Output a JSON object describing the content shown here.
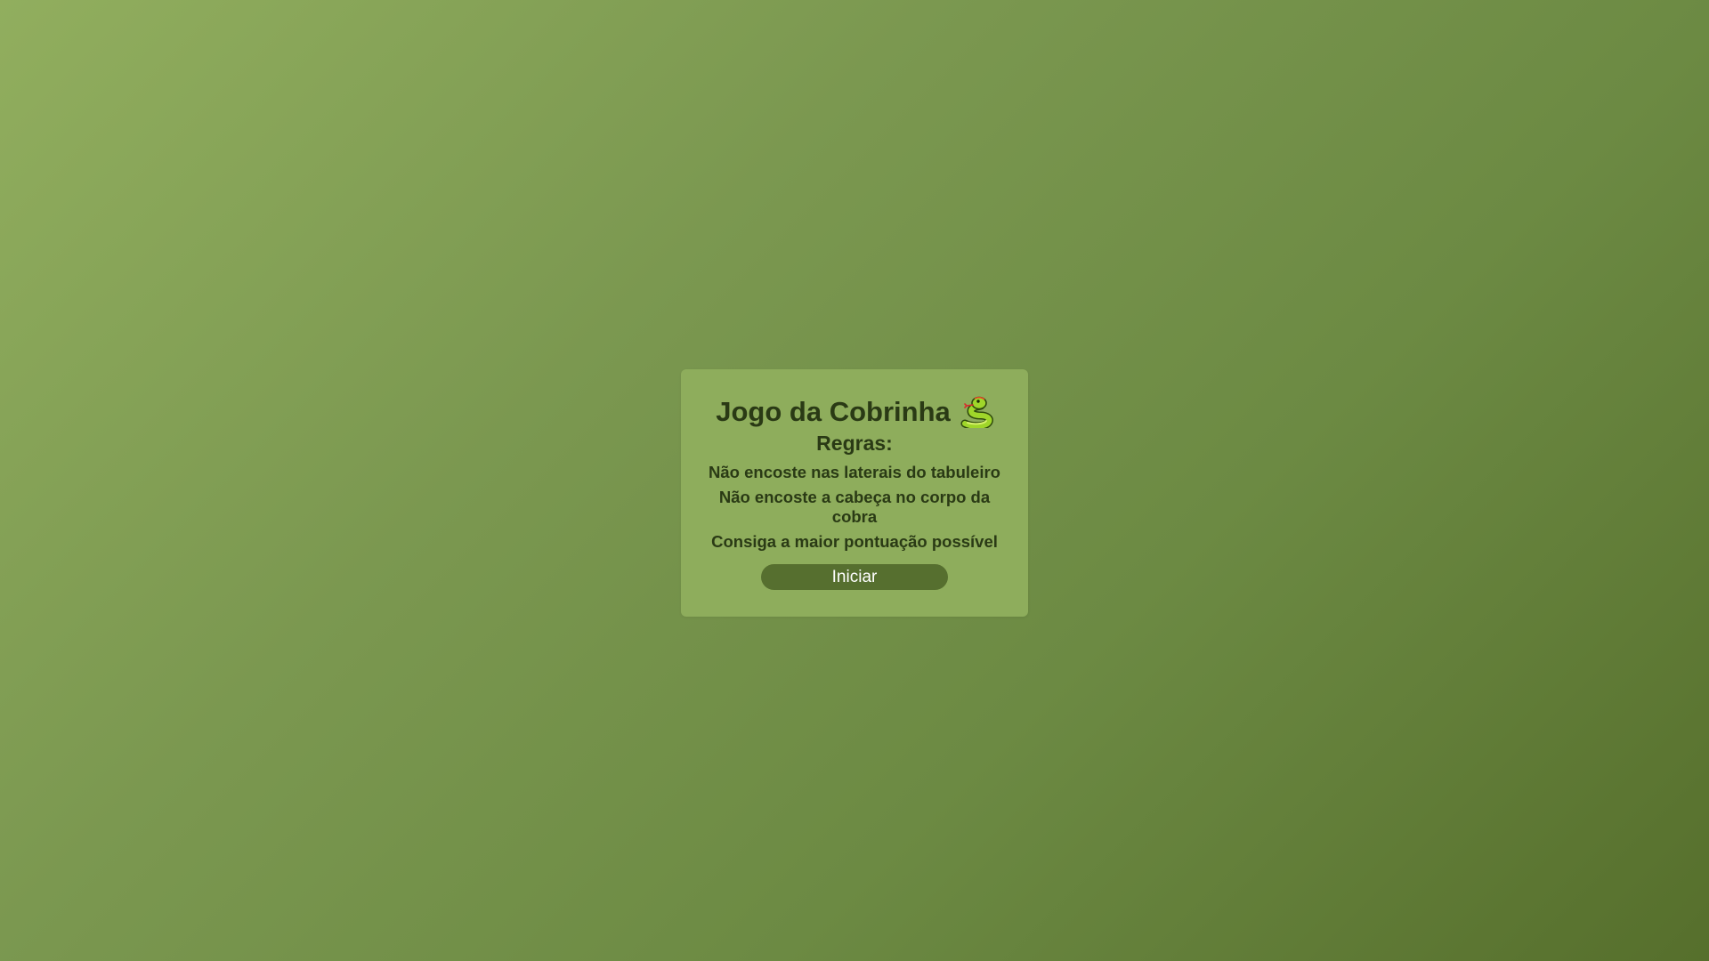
{
  "start_screen": {
    "title": "Jogo da Cobrinha",
    "title_icon": "snake-icon",
    "rules_heading": "Regras:",
    "rules": [
      "Não encoste nas laterais do tabuleiro",
      "Não encoste a cabeça no corpo da cobra",
      "Consiga a maior pontuação possível"
    ],
    "start_button_label": "Iniciar"
  },
  "colors": {
    "background_light": "#91ae5e",
    "background_dark": "#566f2c",
    "card": "#8ead5c",
    "button": "#566f2f",
    "text": "#2a3a15"
  }
}
